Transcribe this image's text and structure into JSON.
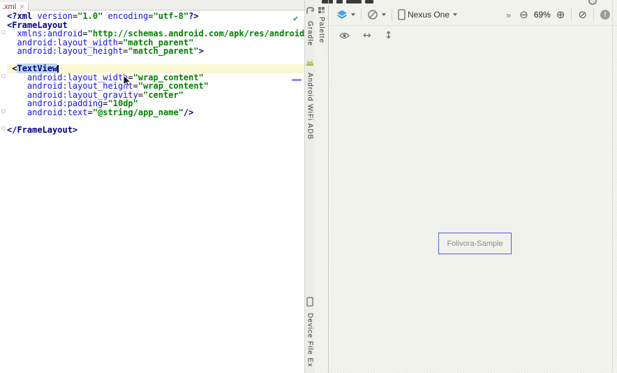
{
  "editor": {
    "tab": {
      "label": ".xml",
      "close_icon": "×"
    },
    "code": {
      "lines": [
        {
          "tokens": [
            [
              "t",
              "<?xml"
            ],
            [
              "p",
              " "
            ],
            [
              "a",
              "version"
            ],
            [
              "p",
              "="
            ],
            [
              "v",
              "\"1.0\""
            ],
            [
              "p",
              " "
            ],
            [
              "a",
              "encoding"
            ],
            [
              "p",
              "="
            ],
            [
              "v",
              "\"utf-8\""
            ],
            [
              "t",
              "?>"
            ]
          ]
        },
        {
          "tokens": [
            [
              "t",
              "<FrameLayout"
            ]
          ]
        },
        {
          "tokens": [
            [
              "p",
              "  "
            ],
            [
              "a",
              "xmlns:android"
            ],
            [
              "p",
              "="
            ],
            [
              "v",
              "\"http://schemas.android.com/apk/res/android\""
            ]
          ]
        },
        {
          "tokens": [
            [
              "p",
              "  "
            ],
            [
              "a",
              "android:layout_width"
            ],
            [
              "p",
              "="
            ],
            [
              "v",
              "\"match_parent\""
            ]
          ]
        },
        {
          "tokens": [
            [
              "p",
              "  "
            ],
            [
              "a",
              "android:layout_height"
            ],
            [
              "p",
              "="
            ],
            [
              "v",
              "\"match_parent\""
            ],
            [
              "t",
              ">"
            ]
          ]
        },
        {
          "tokens": []
        },
        {
          "tokens": [
            [
              "p",
              " "
            ],
            [
              "t",
              "<"
            ],
            [
              "s",
              "TextView"
            ]
          ],
          "hl": true,
          "caret": true
        },
        {
          "tokens": [
            [
              "p",
              "    "
            ],
            [
              "a",
              "android:layout_width"
            ],
            [
              "p",
              "="
            ],
            [
              "v",
              "\"wrap_content\""
            ]
          ]
        },
        {
          "tokens": [
            [
              "p",
              "    "
            ],
            [
              "a",
              "android:layout_height"
            ],
            [
              "p",
              "="
            ],
            [
              "v",
              "\"wrap_content\""
            ]
          ]
        },
        {
          "tokens": [
            [
              "p",
              "    "
            ],
            [
              "a",
              "android:layout_gravity"
            ],
            [
              "p",
              "="
            ],
            [
              "v",
              "\"center\""
            ]
          ]
        },
        {
          "tokens": [
            [
              "p",
              "    "
            ],
            [
              "a",
              "android:padding"
            ],
            [
              "p",
              "="
            ],
            [
              "v",
              "\"10dp\""
            ]
          ]
        },
        {
          "tokens": [
            [
              "p",
              "    "
            ],
            [
              "a",
              "android:text"
            ],
            [
              "p",
              "="
            ],
            [
              "v",
              "\"@string/app_name\""
            ],
            [
              "t",
              "/>"
            ]
          ]
        },
        {
          "tokens": []
        },
        {
          "tokens": [
            [
              "t",
              "</FrameLayout>"
            ]
          ]
        }
      ]
    }
  },
  "indicators": {
    "inspection_check": "✔"
  },
  "right_bar": {
    "top_tabs": [
      {
        "icon": "gradle",
        "label": "Gradle"
      },
      {
        "icon": "android",
        "label": "Android WiFi ADB"
      }
    ],
    "bottom_tabs": [
      {
        "icon": "device",
        "label": "Device File Ex"
      }
    ]
  },
  "designer": {
    "palette": {
      "label": "Palette"
    },
    "toolbar": {
      "device_label": "Nexus One",
      "overflow_label": "»",
      "zoom_out_glyph": "⊖",
      "zoom_label": "69%",
      "zoom_in_glyph": "⊕",
      "zoom_reset_glyph": "⊘",
      "warning_glyph": "!",
      "swap_width_glyph": "↔",
      "swap_height_glyph": "↕"
    },
    "canvas": {
      "widget_label": "Folivora-Sample"
    }
  },
  "colors": {
    "tag": "#000080",
    "attribute": "#1414d6",
    "value": "#008000",
    "selection_bg": "#bdd6f2",
    "line_highlight": "#faf8d2",
    "widget_border": "#5361c5",
    "widget_text": "#8a8a8a"
  }
}
